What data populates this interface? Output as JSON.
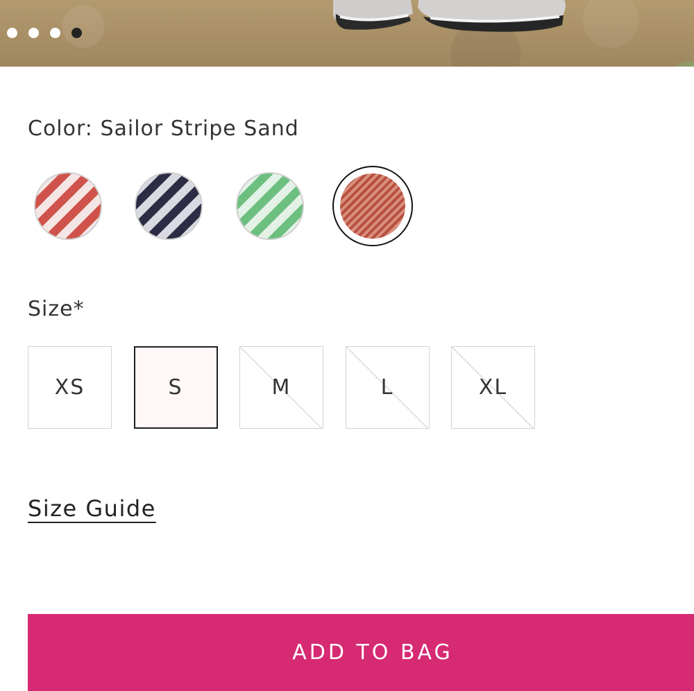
{
  "gallery": {
    "dot_count": 4,
    "active_index": 3
  },
  "color": {
    "label": "Color: Sailor Stripe Sand",
    "swatches": [
      {
        "name": "red-white-stripe",
        "primary": "#d0534b",
        "secondary": "#f4e6e4",
        "selected": false
      },
      {
        "name": "navy-white-stripe",
        "primary": "#2c2c44",
        "secondary": "#d9d9e2",
        "selected": false
      },
      {
        "name": "green-white-stripe",
        "primary": "#6cbf7f",
        "secondary": "#e3f1e6",
        "selected": false
      },
      {
        "name": "sailor-stripe-sand",
        "primary": "#b8503f",
        "secondary": "#d98f7e",
        "selected": true
      }
    ]
  },
  "size": {
    "label": "Size*",
    "options": [
      {
        "label": "XS",
        "available": true,
        "selected": false
      },
      {
        "label": "S",
        "available": true,
        "selected": true
      },
      {
        "label": "M",
        "available": false,
        "selected": false
      },
      {
        "label": "L",
        "available": false,
        "selected": false
      },
      {
        "label": "XL",
        "available": false,
        "selected": false
      }
    ]
  },
  "size_guide": {
    "label": "Size Guide"
  },
  "cta": {
    "label": "ADD TO BAG",
    "color": "#d62a73"
  }
}
